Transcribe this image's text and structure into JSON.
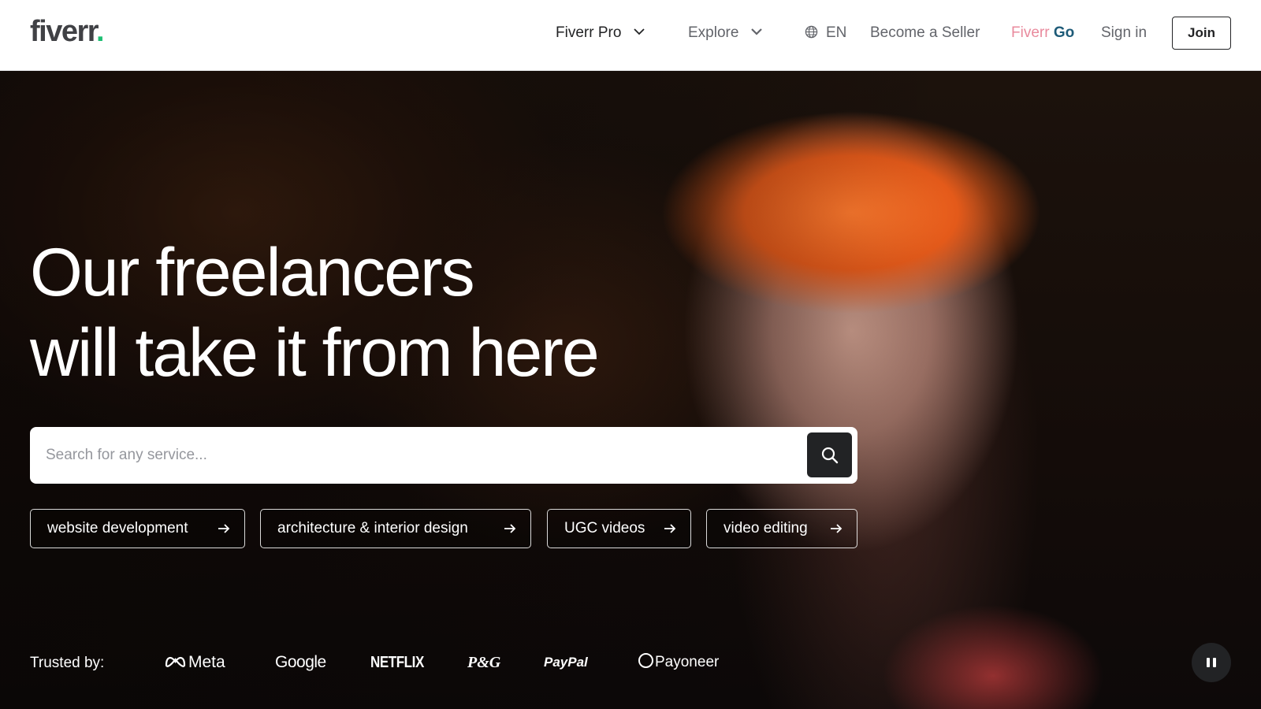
{
  "header": {
    "logo_text": "fiverr",
    "logo_dot": ".",
    "nav": {
      "fiverr_pro": "Fiverr Pro",
      "explore": "Explore",
      "language": "EN",
      "become_seller": "Become a Seller",
      "fiverr_go_part1": "Fiverr",
      "fiverr_go_part2": " Go",
      "sign_in": "Sign in",
      "join": "Join"
    }
  },
  "hero": {
    "headline_line1": "Our freelancers",
    "headline_line2": "will take it from here",
    "search": {
      "placeholder": "Search for any service...",
      "value": ""
    },
    "chips": [
      {
        "label": "website development"
      },
      {
        "label": "architecture & interior design"
      },
      {
        "label": "UGC videos"
      },
      {
        "label": "video editing"
      }
    ],
    "trusted": {
      "label": "Trusted by:",
      "brands": [
        "Meta",
        "Google",
        "NETFLIX",
        "P&G",
        "PayPal",
        "Payoneer"
      ]
    }
  },
  "colors": {
    "brand_green": "#1dbf73",
    "text_dark": "#222325",
    "fiverr_go_pink": "#e98a9d",
    "fiverr_go_blue": "#1e5b78"
  },
  "icons": [
    "chevron-down-icon",
    "globe-icon",
    "search-icon",
    "arrow-right-icon",
    "meta-logo-icon",
    "payoneer-ring-icon",
    "pause-icon"
  ]
}
